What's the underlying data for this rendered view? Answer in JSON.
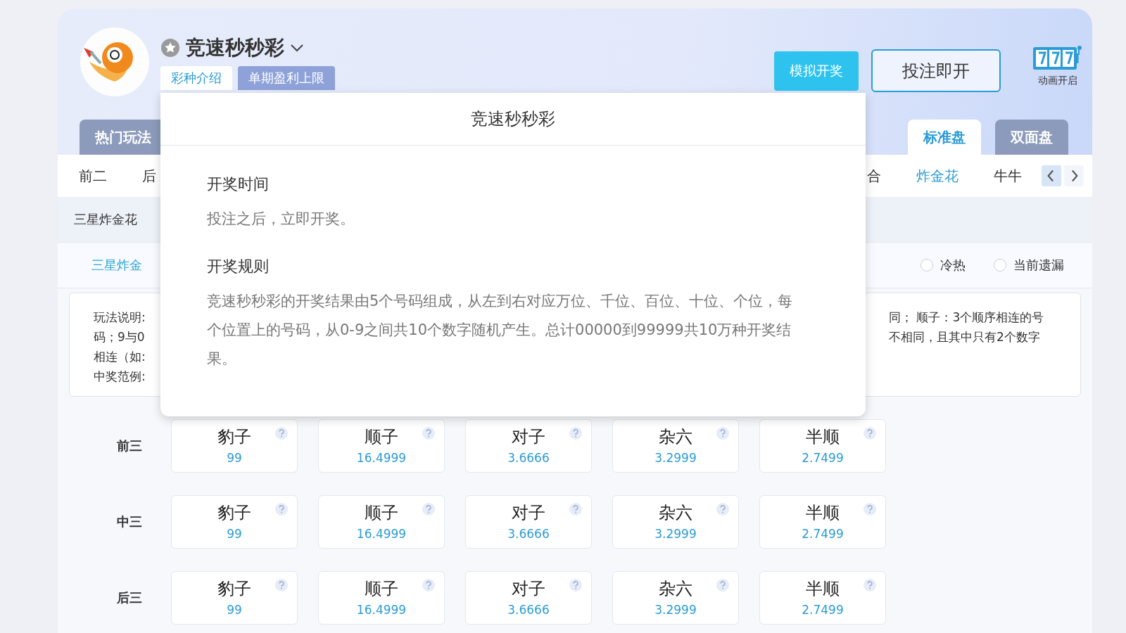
{
  "lottery": {
    "title": "竞速秒秒彩"
  },
  "info_tabs": [
    {
      "label": "彩种介绍",
      "selected": true
    },
    {
      "label": "单期盈利上限",
      "selected": false
    }
  ],
  "actions": [
    {
      "label": "模拟开奖",
      "kind": "filled"
    },
    {
      "label": "投注即开",
      "kind": "outline"
    }
  ],
  "animation_toggle": {
    "label": "动画开启"
  },
  "category_tabs": [
    {
      "label": "热门玩法",
      "selected": false
    }
  ],
  "mode_tabs": [
    {
      "label": "标准盘",
      "selected": true
    },
    {
      "label": "双面盘",
      "selected": false
    }
  ],
  "play_nav": {
    "left": [
      {
        "label": "前二",
        "selected": false
      },
      {
        "label": "后",
        "selected": false
      }
    ],
    "right": [
      {
        "label": "合",
        "selected": false
      },
      {
        "label": "炸金花",
        "selected": true
      },
      {
        "label": "牛牛",
        "selected": false
      }
    ]
  },
  "sub_nav": [
    {
      "label": "三星炸金花"
    }
  ],
  "play_tabs": [
    {
      "label": "三星炸金",
      "selected": true
    }
  ],
  "stats_options": [
    {
      "label": "冷热",
      "selected": false
    },
    {
      "label": "当前遗漏",
      "selected": false
    }
  ],
  "description": {
    "left_lines": [
      "玩法说明:",
      "码；9与0",
      "相连（如:",
      "中奖范例:"
    ],
    "right_lines": [
      "同； 顺子：3个顺序相连的号",
      "不相同，且其中只有2个数字"
    ]
  },
  "bet_rows": [
    {
      "label": "前三",
      "options": [
        {
          "name": "豹子",
          "odds": "99"
        },
        {
          "name": "顺子",
          "odds": "16.4999"
        },
        {
          "name": "对子",
          "odds": "3.6666"
        },
        {
          "name": "杂六",
          "odds": "3.2999"
        },
        {
          "name": "半顺",
          "odds": "2.7499"
        }
      ]
    },
    {
      "label": "中三",
      "options": [
        {
          "name": "豹子",
          "odds": "99"
        },
        {
          "name": "顺子",
          "odds": "16.4999"
        },
        {
          "name": "对子",
          "odds": "3.6666"
        },
        {
          "name": "杂六",
          "odds": "3.2999"
        },
        {
          "name": "半顺",
          "odds": "2.7499"
        }
      ]
    },
    {
      "label": "后三",
      "options": [
        {
          "name": "豹子",
          "odds": "99"
        },
        {
          "name": "顺子",
          "odds": "16.4999"
        },
        {
          "name": "对子",
          "odds": "3.6666"
        },
        {
          "name": "杂六",
          "odds": "3.2999"
        },
        {
          "name": "半顺",
          "odds": "2.7499"
        }
      ]
    }
  ],
  "intro_popup": {
    "title": "竞速秒秒彩",
    "sections": [
      {
        "heading": "开奖时间",
        "text": "投注之后，立即开奖。"
      },
      {
        "heading": "开奖规则",
        "text": "竞速秒秒彩的开奖结果由5个号码组成，从左到右对应万位、千位、百位、十位、个位，每个位置上的号码，从0-9之间共10个数字随机产生。总计00000到99999共10万种开奖结果。"
      }
    ]
  }
}
